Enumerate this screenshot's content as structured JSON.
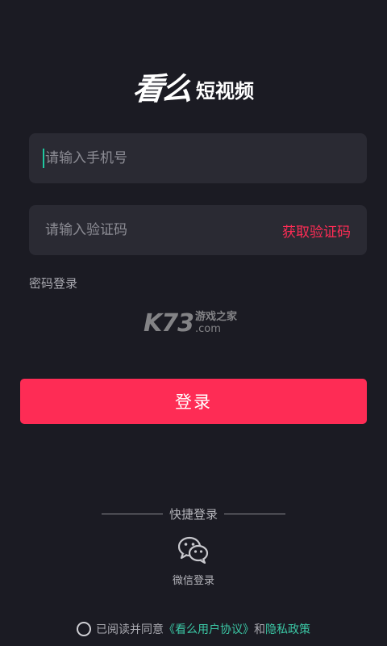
{
  "logo": {
    "main": "看么",
    "sub": "短视频"
  },
  "phone_field": {
    "placeholder": "请输入手机号"
  },
  "code_field": {
    "placeholder": "请输入验证码",
    "get_code_label": "获取验证码"
  },
  "password_login_label": "密码登录",
  "watermark": {
    "big": "K73",
    "top": "游戏之家",
    "bottom": ".com"
  },
  "login_button_label": "登录",
  "quick_login": {
    "label": "快捷登录",
    "wechat_label": "微信登录"
  },
  "agreement": {
    "prefix": "已阅读并同意",
    "user_agreement": "《看么用户协议》",
    "and": "和",
    "privacy_policy": "隐私政策"
  },
  "colors": {
    "background": "#1b1b23",
    "field": "#2a2a33",
    "accent": "#fe2c55",
    "link": "#3bc7a5"
  },
  "icons": [
    "wechat-icon",
    "agree-checkbox-icon"
  ]
}
